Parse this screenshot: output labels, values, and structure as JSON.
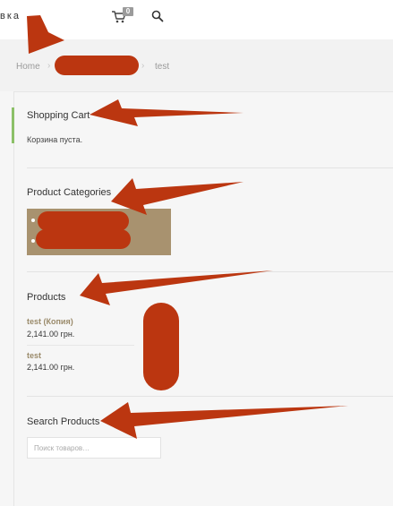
{
  "header": {
    "menu_text": "вка",
    "cart_count": "0",
    "icons": {
      "cart": "shopping-cart-icon",
      "search": "magnifier-icon"
    }
  },
  "breadcrumb": {
    "home": "Home",
    "separator": "›",
    "current": "test"
  },
  "widgets": {
    "cart": {
      "title": "Shopping Cart",
      "empty_text": "Корзина пуста."
    },
    "categories": {
      "title": "Product Categories"
    },
    "products": {
      "title": "Products",
      "items": [
        {
          "name": "test (Копия)",
          "price": "2,141.00 грн."
        },
        {
          "name": "test",
          "price": "2,141.00 грн."
        }
      ]
    },
    "search": {
      "title": "Search Products",
      "placeholder": "Поиск товаров…"
    }
  },
  "colors": {
    "annotation_arrow": "#bb3610",
    "redaction": "#bb3610",
    "accent_green": "#8cc068",
    "category_box": "#a8926f",
    "product_link": "#9a8a6a"
  }
}
